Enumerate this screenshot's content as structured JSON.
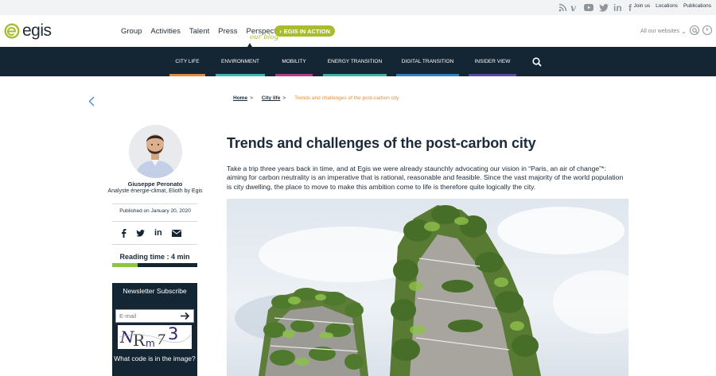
{
  "topbar": {
    "social_icons": [
      "rss-icon",
      "vimeo-icon",
      "youtube-icon",
      "twitter-icon",
      "linkedin-icon",
      "facebook-icon"
    ],
    "links": [
      "Join us",
      "Locations",
      "Publications"
    ]
  },
  "header": {
    "logo_text": "egis",
    "nav": [
      "Group",
      "Activities",
      "Talent",
      "Press",
      "Perspectives"
    ],
    "blog_label": "our blog",
    "action_button": "EGIS IN ACTION",
    "all_websites": "All our websites",
    "lang_fr": "fr"
  },
  "categories": [
    {
      "label": "CITY LIFE",
      "color": "#e6883a"
    },
    {
      "label": "ENVIRONMENT",
      "color": "#3fb7b7"
    },
    {
      "label": "MOBILITY",
      "color": "#b73b8c"
    },
    {
      "label": "ENERGY TRANSITION",
      "color": "#36b49f"
    },
    {
      "label": "DIGITAL TRANSITION",
      "color": "#2f7fc7"
    },
    {
      "label": "INSIDER VIEW",
      "color": "#5a4aa5"
    }
  ],
  "breadcrumb": {
    "home": "Home",
    "section": "City life",
    "separator": ">",
    "current": "Trends and challenges of the post-carbon city"
  },
  "author": {
    "name": "Giuseppe Peronato",
    "role": "Analyste énergie-climat, Elioth by Egis",
    "published": "Published on January 20, 2020"
  },
  "share_icons": [
    "facebook-icon",
    "twitter-icon",
    "linkedin-icon",
    "mail-icon"
  ],
  "reading": {
    "label": "Reading time : 4 min",
    "progress": 0.3
  },
  "newsletter": {
    "title": "Newsletter Subscribe",
    "email_placeholder": "E-mail",
    "captcha_text": "NR m 73",
    "code_question": "What code is in the image?"
  },
  "article": {
    "title": "Trends and challenges of the post-carbon city",
    "intro": "Take a trip three years back in time, and at Egis we were already staunchly advocating our vision in “Paris, an air of change”*: aiming for carbon neutrality is an imperative that is rational, reasonable and feasible. Since the vast majority of the world population is city dwelling, the place to move to make this ambition come to life is therefore quite logically the city."
  }
}
